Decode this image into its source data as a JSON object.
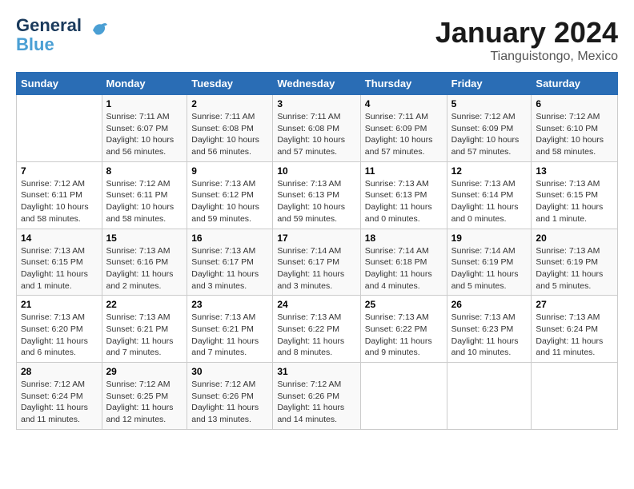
{
  "logo": {
    "line1": "General",
    "line2": "Blue"
  },
  "title": "January 2024",
  "subtitle": "Tianguistongo, Mexico",
  "days_header": [
    "Sunday",
    "Monday",
    "Tuesday",
    "Wednesday",
    "Thursday",
    "Friday",
    "Saturday"
  ],
  "weeks": [
    [
      {
        "day": "",
        "info": ""
      },
      {
        "day": "1",
        "info": "Sunrise: 7:11 AM\nSunset: 6:07 PM\nDaylight: 10 hours\nand 56 minutes."
      },
      {
        "day": "2",
        "info": "Sunrise: 7:11 AM\nSunset: 6:08 PM\nDaylight: 10 hours\nand 56 minutes."
      },
      {
        "day": "3",
        "info": "Sunrise: 7:11 AM\nSunset: 6:08 PM\nDaylight: 10 hours\nand 57 minutes."
      },
      {
        "day": "4",
        "info": "Sunrise: 7:11 AM\nSunset: 6:09 PM\nDaylight: 10 hours\nand 57 minutes."
      },
      {
        "day": "5",
        "info": "Sunrise: 7:12 AM\nSunset: 6:09 PM\nDaylight: 10 hours\nand 57 minutes."
      },
      {
        "day": "6",
        "info": "Sunrise: 7:12 AM\nSunset: 6:10 PM\nDaylight: 10 hours\nand 58 minutes."
      }
    ],
    [
      {
        "day": "7",
        "info": "Sunrise: 7:12 AM\nSunset: 6:11 PM\nDaylight: 10 hours\nand 58 minutes."
      },
      {
        "day": "8",
        "info": "Sunrise: 7:12 AM\nSunset: 6:11 PM\nDaylight: 10 hours\nand 58 minutes."
      },
      {
        "day": "9",
        "info": "Sunrise: 7:13 AM\nSunset: 6:12 PM\nDaylight: 10 hours\nand 59 minutes."
      },
      {
        "day": "10",
        "info": "Sunrise: 7:13 AM\nSunset: 6:13 PM\nDaylight: 10 hours\nand 59 minutes."
      },
      {
        "day": "11",
        "info": "Sunrise: 7:13 AM\nSunset: 6:13 PM\nDaylight: 11 hours\nand 0 minutes."
      },
      {
        "day": "12",
        "info": "Sunrise: 7:13 AM\nSunset: 6:14 PM\nDaylight: 11 hours\nand 0 minutes."
      },
      {
        "day": "13",
        "info": "Sunrise: 7:13 AM\nSunset: 6:15 PM\nDaylight: 11 hours\nand 1 minute."
      }
    ],
    [
      {
        "day": "14",
        "info": "Sunrise: 7:13 AM\nSunset: 6:15 PM\nDaylight: 11 hours\nand 1 minute."
      },
      {
        "day": "15",
        "info": "Sunrise: 7:13 AM\nSunset: 6:16 PM\nDaylight: 11 hours\nand 2 minutes."
      },
      {
        "day": "16",
        "info": "Sunrise: 7:13 AM\nSunset: 6:17 PM\nDaylight: 11 hours\nand 3 minutes."
      },
      {
        "day": "17",
        "info": "Sunrise: 7:14 AM\nSunset: 6:17 PM\nDaylight: 11 hours\nand 3 minutes."
      },
      {
        "day": "18",
        "info": "Sunrise: 7:14 AM\nSunset: 6:18 PM\nDaylight: 11 hours\nand 4 minutes."
      },
      {
        "day": "19",
        "info": "Sunrise: 7:14 AM\nSunset: 6:19 PM\nDaylight: 11 hours\nand 5 minutes."
      },
      {
        "day": "20",
        "info": "Sunrise: 7:13 AM\nSunset: 6:19 PM\nDaylight: 11 hours\nand 5 minutes."
      }
    ],
    [
      {
        "day": "21",
        "info": "Sunrise: 7:13 AM\nSunset: 6:20 PM\nDaylight: 11 hours\nand 6 minutes."
      },
      {
        "day": "22",
        "info": "Sunrise: 7:13 AM\nSunset: 6:21 PM\nDaylight: 11 hours\nand 7 minutes."
      },
      {
        "day": "23",
        "info": "Sunrise: 7:13 AM\nSunset: 6:21 PM\nDaylight: 11 hours\nand 7 minutes."
      },
      {
        "day": "24",
        "info": "Sunrise: 7:13 AM\nSunset: 6:22 PM\nDaylight: 11 hours\nand 8 minutes."
      },
      {
        "day": "25",
        "info": "Sunrise: 7:13 AM\nSunset: 6:22 PM\nDaylight: 11 hours\nand 9 minutes."
      },
      {
        "day": "26",
        "info": "Sunrise: 7:13 AM\nSunset: 6:23 PM\nDaylight: 11 hours\nand 10 minutes."
      },
      {
        "day": "27",
        "info": "Sunrise: 7:13 AM\nSunset: 6:24 PM\nDaylight: 11 hours\nand 11 minutes."
      }
    ],
    [
      {
        "day": "28",
        "info": "Sunrise: 7:12 AM\nSunset: 6:24 PM\nDaylight: 11 hours\nand 11 minutes."
      },
      {
        "day": "29",
        "info": "Sunrise: 7:12 AM\nSunset: 6:25 PM\nDaylight: 11 hours\nand 12 minutes."
      },
      {
        "day": "30",
        "info": "Sunrise: 7:12 AM\nSunset: 6:26 PM\nDaylight: 11 hours\nand 13 minutes."
      },
      {
        "day": "31",
        "info": "Sunrise: 7:12 AM\nSunset: 6:26 PM\nDaylight: 11 hours\nand 14 minutes."
      },
      {
        "day": "",
        "info": ""
      },
      {
        "day": "",
        "info": ""
      },
      {
        "day": "",
        "info": ""
      }
    ]
  ]
}
